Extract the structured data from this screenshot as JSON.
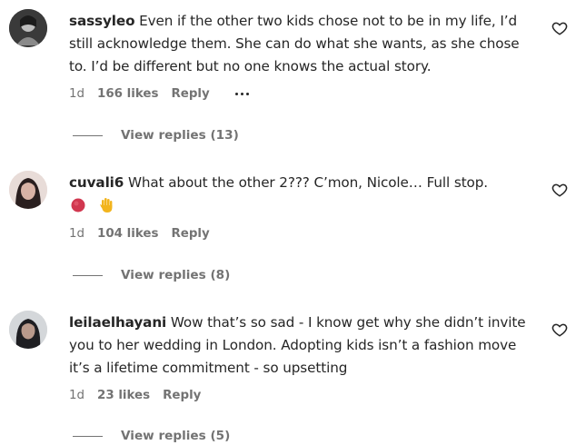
{
  "comments": [
    {
      "username": "sassyleo",
      "text": "Even if the other two kids chose not to be in my life, I’d still acknowledge them. She can do what she wants, as she chose to. I’d be different but no one knows the actual story.",
      "time": "1d",
      "likes": "166 likes",
      "reply_label": "Reply",
      "view_replies": "View replies (13)"
    },
    {
      "username": "cuvali6",
      "text": "What about the other 2??? C’mon, Nicole… Full stop.",
      "emoji": [
        "red-circle",
        "raised-hand"
      ],
      "time": "1d",
      "likes": "104 likes",
      "reply_label": "Reply",
      "view_replies": "View replies (8)"
    },
    {
      "username": "leilaelhayani",
      "text": "Wow that’s so sad - I know get why she didn’t invite you to her wedding in London. Adopting kids isn’t a fashion move it’s a lifetime commitment - so upsetting",
      "time": "1d",
      "likes": "23 likes",
      "reply_label": "Reply",
      "view_replies": "View replies (5)"
    }
  ],
  "icons": {
    "heart": "heart-outline-icon",
    "more": "more-options-icon"
  },
  "colors": {
    "text": "#262626",
    "secondary": "#737373",
    "background": "#ffffff"
  }
}
